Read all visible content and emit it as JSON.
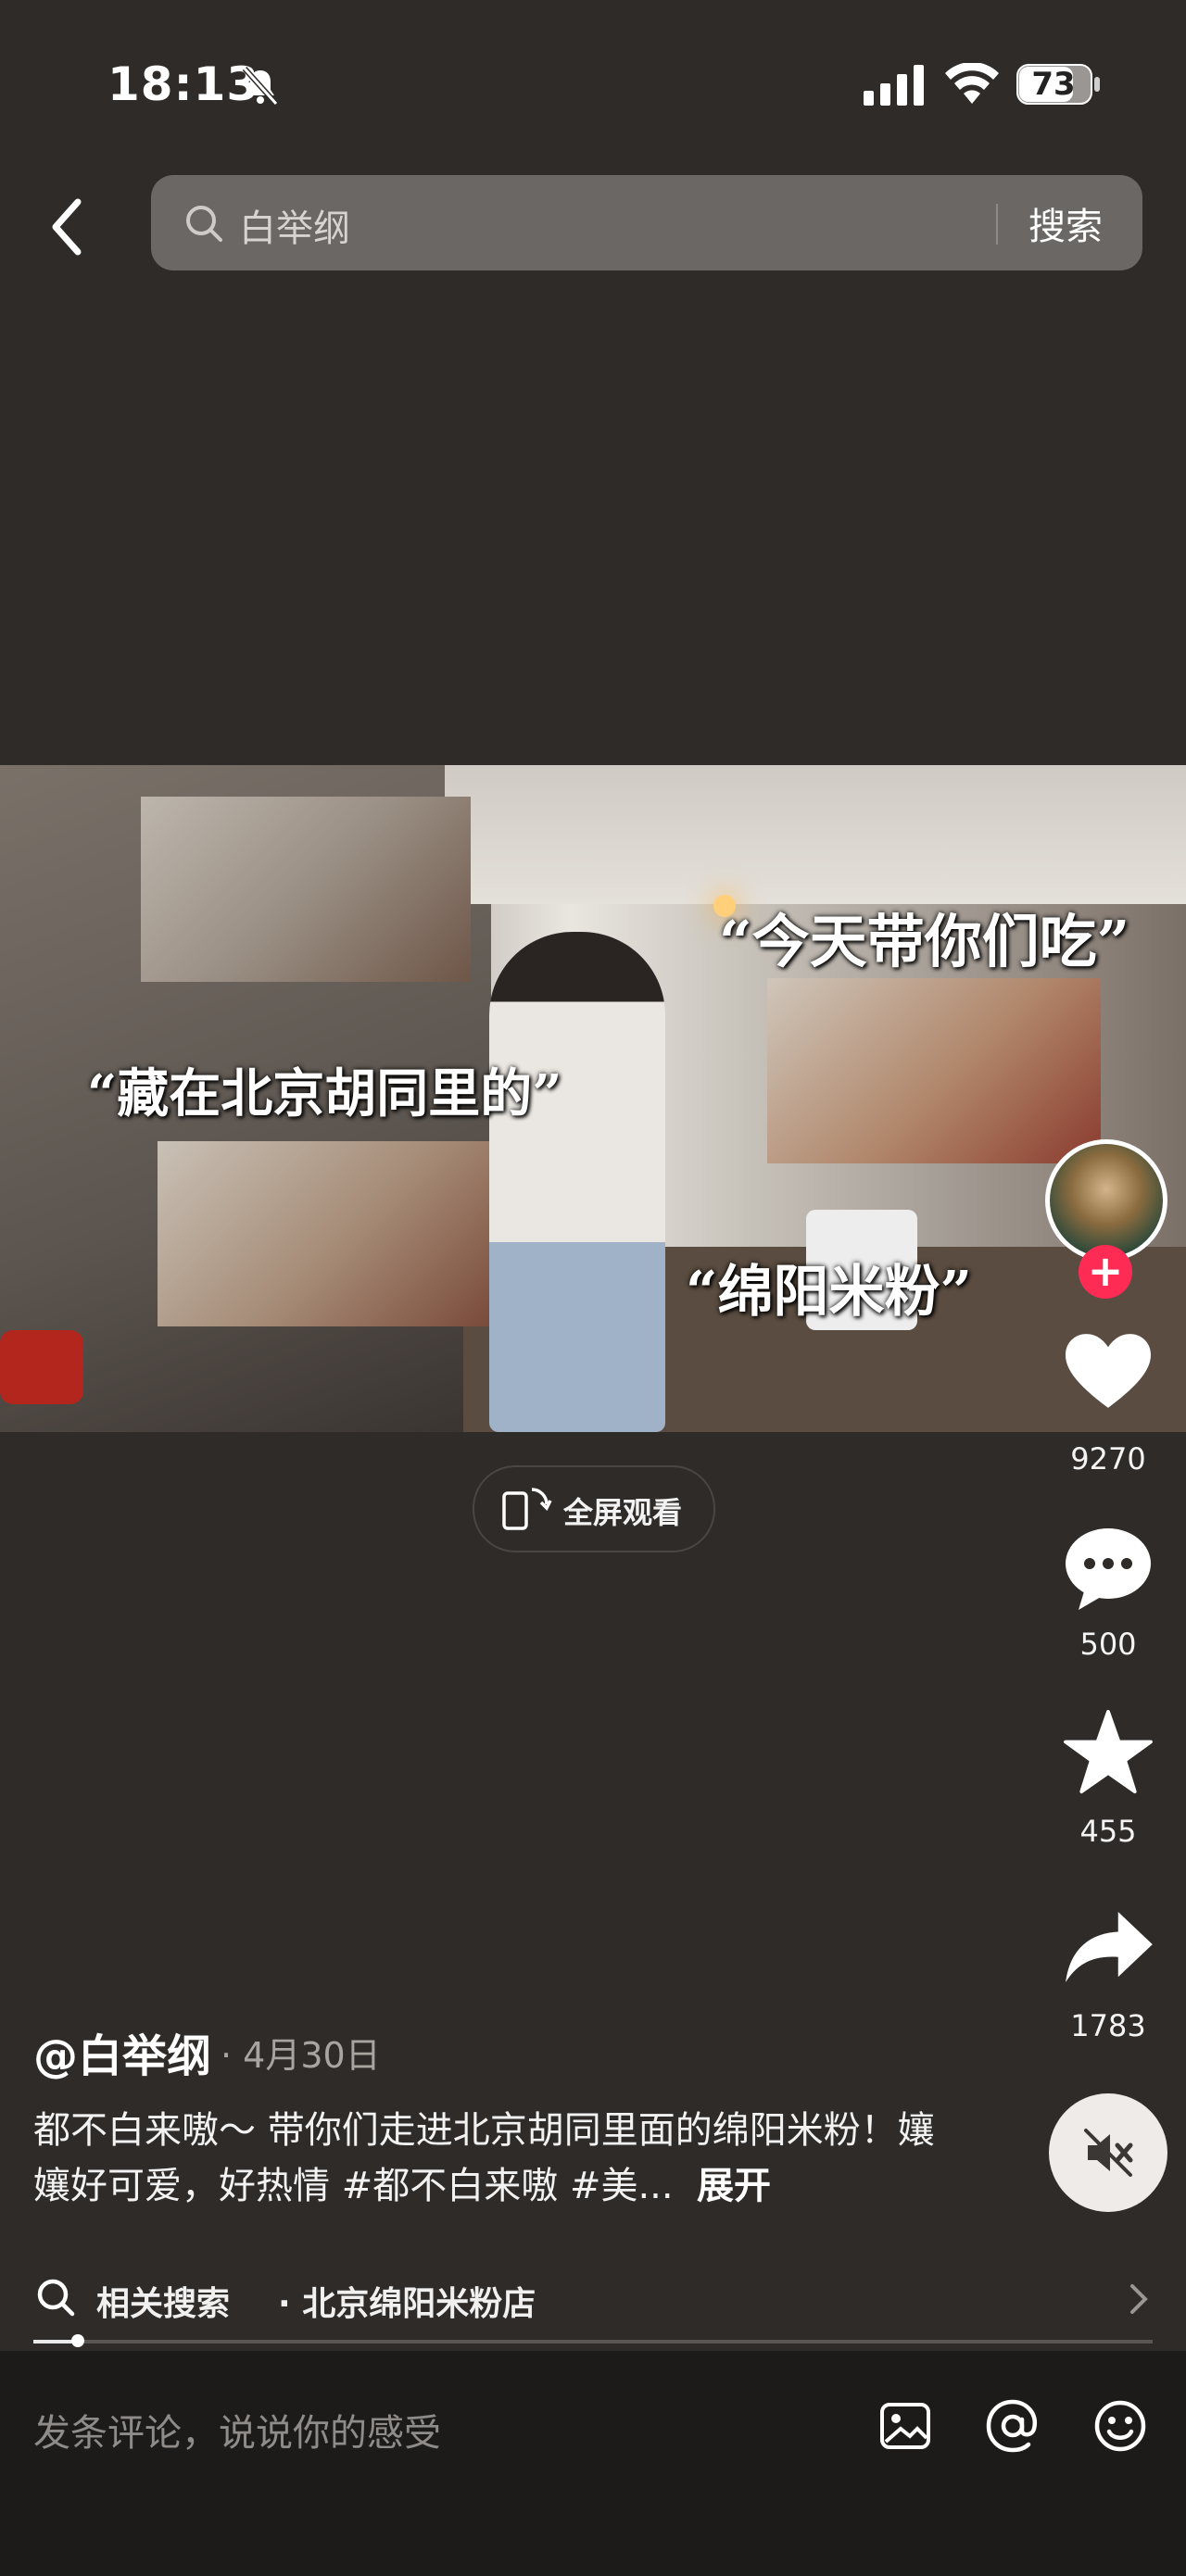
{
  "status_bar": {
    "time": "18:13",
    "battery": "73"
  },
  "search": {
    "query": "白举纲",
    "button_label": "搜索"
  },
  "video": {
    "captions": [
      "“今天带你们吃”",
      "“藏在北京胡同里的”",
      "“绵阳米粉”"
    ]
  },
  "fullscreen": {
    "label": "全屏观看"
  },
  "actions": {
    "likes": "9270",
    "comments": "500",
    "favorites": "455",
    "shares": "1783"
  },
  "post": {
    "author": "@白举纲",
    "date": "· 4月30日",
    "description": "都不白来嗷～ 带你们走进北京胡同里面的绵阳米粉！孃孃好可爱，好热情 #都不白来嗷 #美...",
    "expand_label": "展开"
  },
  "related": {
    "label": "相关搜索",
    "query": "· 北京绵阳米粉店"
  },
  "progress": {
    "fraction": 0.04
  },
  "comment": {
    "placeholder": "发条评论，说说你的感受"
  },
  "icons": {
    "back": "chevron-left-icon",
    "search": "search-icon",
    "like": "heart-icon",
    "comment": "comment-icon",
    "favorite": "star-icon",
    "share": "share-icon",
    "mute": "speaker-muted-icon",
    "image": "image-icon",
    "mention": "at-icon",
    "emoji": "emoji-icon"
  }
}
